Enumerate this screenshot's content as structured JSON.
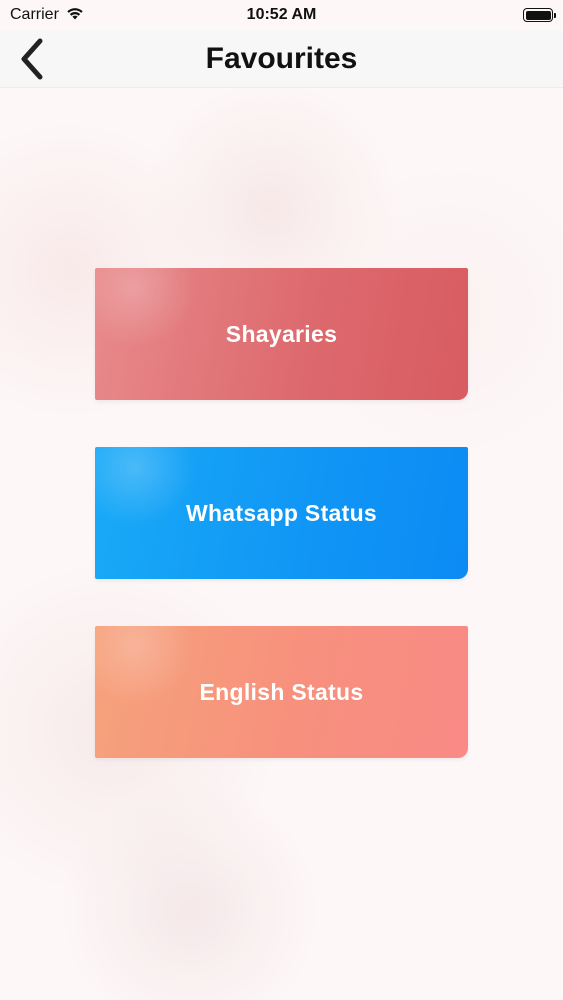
{
  "status_bar": {
    "carrier": "Carrier",
    "time": "10:52 AM"
  },
  "nav": {
    "title": "Favourites",
    "back_icon": "chevron-left-icon"
  },
  "categories": [
    {
      "label": "Shayaries",
      "color": "#dd6a6e"
    },
    {
      "label": "Whatsapp Status",
      "color": "#1095f5"
    },
    {
      "label": "English Status",
      "color": "#f7907d"
    }
  ]
}
